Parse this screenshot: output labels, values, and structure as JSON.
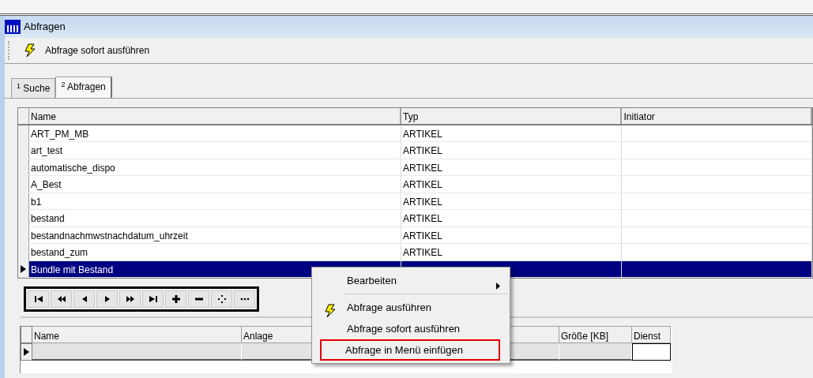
{
  "window": {
    "title": "Abfragen"
  },
  "toolbar": [
    {
      "label": "Abfrage sofort ausführen"
    }
  ],
  "tabs": [
    {
      "key": "1",
      "label": "Suche",
      "selected": false
    },
    {
      "key": "2",
      "label": "Abfragen",
      "selected": true
    }
  ],
  "query_table": {
    "columns": [
      "Name",
      "Typ",
      "Initiator"
    ],
    "rows": [
      {
        "name": "ART_PM_MB",
        "type": "ARTIKEL",
        "selected": false
      },
      {
        "name": "art_test",
        "type": "ARTIKEL",
        "selected": false
      },
      {
        "name": "automatische_dispo",
        "type": "ARTIKEL",
        "selected": false
      },
      {
        "name": "A_Best",
        "type": "ARTIKEL",
        "selected": false
      },
      {
        "name": "b1",
        "type": "ARTIKEL",
        "selected": false
      },
      {
        "name": "bestand",
        "type": "ARTIKEL",
        "selected": false
      },
      {
        "name": "bestandnachmwstnachdatum_uhrzeit",
        "type": "ARTIKEL",
        "selected": false
      },
      {
        "name": "bestand_zum",
        "type": "ARTIKEL",
        "selected": false
      },
      {
        "name": "Bundle mit Bestand",
        "selected": true
      }
    ]
  },
  "navigator": [
    {
      "kind": "first"
    },
    {
      "kind": "prior-page"
    },
    {
      "kind": "prior"
    },
    {
      "kind": "next"
    },
    {
      "kind": "next-page"
    },
    {
      "kind": "last"
    },
    {
      "kind": "insert"
    },
    {
      "kind": "delete"
    },
    {
      "kind": "move"
    },
    {
      "kind": "more"
    }
  ],
  "detail_table": {
    "columns": [
      "Name",
      "Anlage",
      "",
      "Größe [KB]",
      "Dienst"
    ],
    "rows": [
      {
        "current": true
      }
    ]
  },
  "context_menu": [
    {
      "kind": "submenu",
      "label": "Bearbeiten",
      "highlighted": false
    },
    {
      "kind": "separator"
    },
    {
      "kind": "icon-item",
      "label": "Abfrage ausführen",
      "highlighted": false
    },
    {
      "kind": "item",
      "label": "Abfrage sofort ausführen",
      "highlighted": false
    },
    {
      "kind": "item",
      "label": "Abfrage in Menü einfügen",
      "highlighted": true
    }
  ]
}
